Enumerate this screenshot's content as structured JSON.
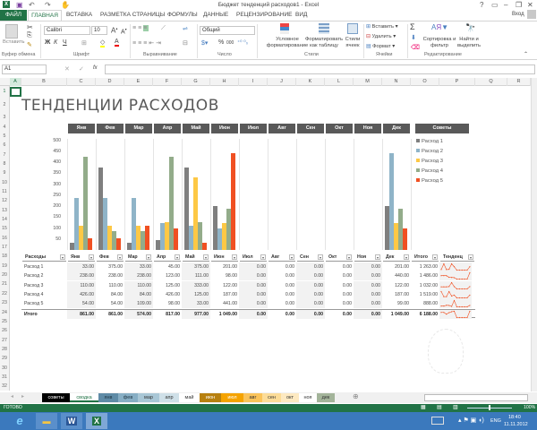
{
  "window": {
    "title": "Бюджет тенденций расходов1 - Excel",
    "help": "?",
    "user": "Вход"
  },
  "ribbon_tabs": [
    "ФАЙЛ",
    "ГЛАВНАЯ",
    "ВСТАВКА",
    "РАЗМЕТКА СТРАНИЦЫ",
    "ФОРМУЛЫ",
    "ДАННЫЕ",
    "РЕЦЕНЗИРОВАНИЕ",
    "ВИД"
  ],
  "ribbon": {
    "paste": "Вставить",
    "font_name": "Calibri",
    "font_size": "10",
    "bold": "Ж",
    "italic": "К",
    "underline": "Ч",
    "number_format": "Общий",
    "percent": "%",
    "thousands": "000",
    "cond_format": "Условное форматирование",
    "format_table": "Форматировать как таблицу",
    "cell_styles": "Стили ячеек",
    "insert": "Вставить",
    "delete": "Удалить",
    "format": "Формат",
    "sum": "Σ",
    "sort": "Сортировка и фильтр",
    "find": "Найти и выделить",
    "groups": [
      "Буфер обмена",
      "Шрифт",
      "Выравнивание",
      "Число",
      "Стили",
      "Ячейки",
      "Редактирование"
    ]
  },
  "formula_bar": {
    "name_box": "A1",
    "fx": "fx",
    "value": ""
  },
  "columns": [
    "A",
    "B",
    "C",
    "D",
    "E",
    "F",
    "G",
    "H",
    "I",
    "J",
    "K",
    "L",
    "M",
    "N",
    "O",
    "P",
    "Q",
    "R"
  ],
  "rows": [
    "1",
    "2",
    "3",
    "4",
    "5",
    "6",
    "7",
    "8",
    "9",
    "10",
    "11",
    "12",
    "13",
    "14",
    "15",
    "16",
    "17",
    "18",
    "19",
    "20",
    "21",
    "22",
    "23",
    "24",
    "25",
    "26",
    "27",
    "28",
    "29",
    "30",
    "31",
    "32"
  ],
  "sheet_title": "ТЕНДЕНЦИИ РАСХОДОВ",
  "tips_header": "Советы",
  "colors": {
    "Расход 1": "#7f7f7f",
    "Расход 2": "#8fb4c8",
    "Расход 3": "#fdc845",
    "Расход 4": "#93ac8a",
    "Расход 5": "#f05022",
    "header": "#595959",
    "excel_green": "#217346"
  },
  "chart_data": {
    "type": "bar",
    "title": "",
    "xlabel": "",
    "ylabel": "",
    "ylim": [
      0,
      500
    ],
    "y_ticks": [
      "500",
      "450",
      "400",
      "350",
      "300",
      "250",
      "200",
      "150",
      "100",
      "50"
    ],
    "categories": [
      "Янв",
      "Фев",
      "Мар",
      "Апр",
      "Май",
      "Июн",
      "Июл",
      "Авг",
      "Сен",
      "Окт",
      "Ноя",
      "Дек"
    ],
    "legend_position": "right",
    "series": [
      {
        "name": "Расход 1",
        "values": [
          33,
          375,
          33,
          45,
          375,
          201,
          0,
          0,
          0,
          0,
          0,
          201
        ]
      },
      {
        "name": "Расход 2",
        "values": [
          238,
          238,
          238,
          123,
          111,
          98,
          0,
          0,
          0,
          0,
          0,
          440
        ]
      },
      {
        "name": "Расход 3",
        "values": [
          110,
          110,
          110,
          125,
          333,
          122,
          0,
          0,
          0,
          0,
          0,
          122
        ]
      },
      {
        "name": "Расход 4",
        "values": [
          426,
          84,
          84,
          426,
          125,
          187,
          0,
          0,
          0,
          0,
          0,
          187
        ]
      },
      {
        "name": "Расход 5",
        "values": [
          54,
          54,
          109,
          98,
          33,
          441,
          0,
          0,
          0,
          0,
          0,
          99
        ]
      }
    ]
  },
  "table": {
    "headers": [
      "Расходы",
      "Янв",
      "Фев",
      "Мар",
      "Апр",
      "Май",
      "Июн",
      "Июл",
      "Авг",
      "Сен",
      "Окт",
      "Ноя",
      "Дек",
      "Итого",
      "Тенденц"
    ],
    "rows": [
      [
        "Расход 1",
        "33.00",
        "375.00",
        "33.00",
        "45.00",
        "375.00",
        "201.00",
        "0.00",
        "0.00",
        "0.00",
        "0.00",
        "0.00",
        "201.00",
        "1 263.00"
      ],
      [
        "Расход 2",
        "238.00",
        "238.00",
        "238.00",
        "123.00",
        "111.00",
        "98.00",
        "0.00",
        "0.00",
        "0.00",
        "0.00",
        "0.00",
        "440.00",
        "1 486.00"
      ],
      [
        "Расход 3",
        "110.00",
        "110.00",
        "110.00",
        "125.00",
        "333.00",
        "122.00",
        "0.00",
        "0.00",
        "0.00",
        "0.00",
        "0.00",
        "122.00",
        "1 032.00"
      ],
      [
        "Расход 4",
        "426.00",
        "84.00",
        "84.00",
        "426.00",
        "125.00",
        "187.00",
        "0.00",
        "0.00",
        "0.00",
        "0.00",
        "0.00",
        "187.00",
        "1 519.00"
      ],
      [
        "Расход 5",
        "54.00",
        "54.00",
        "109.00",
        "98.00",
        "33.00",
        "441.00",
        "0.00",
        "0.00",
        "0.00",
        "0.00",
        "0.00",
        "99.00",
        "888.00"
      ]
    ],
    "total": [
      "Итого",
      "861.00",
      "861.00",
      "574.00",
      "817.00",
      "977.00",
      "1 049.00",
      "0.00",
      "0.00",
      "0.00",
      "0.00",
      "0.00",
      "1 049.00",
      "6 188.00"
    ]
  },
  "sheet_tabs": [
    {
      "label": "советы",
      "bg": "#000000",
      "fg": "#ffffff"
    },
    {
      "label": "сводка",
      "bg": "#ffffff",
      "fg": "#217346"
    },
    {
      "label": "янв",
      "bg": "#5f8ba6",
      "fg": "#1f3440"
    },
    {
      "label": "фев",
      "bg": "#87aec4",
      "fg": "#1f3440"
    },
    {
      "label": "мар",
      "bg": "#a9c7d6",
      "fg": "#333333"
    },
    {
      "label": "апр",
      "bg": "#cfe0e8",
      "fg": "#333333"
    },
    {
      "label": "май",
      "bg": "#ffffff",
      "fg": "#333333"
    },
    {
      "label": "июн",
      "bg": "#b7800f",
      "fg": "#ffffff"
    },
    {
      "label": "июл",
      "bg": "#f5a300",
      "fg": "#ffffff"
    },
    {
      "label": "авг",
      "bg": "#fac35a",
      "fg": "#333333"
    },
    {
      "label": "сен",
      "bg": "#fcdc98",
      "fg": "#333333"
    },
    {
      "label": "окт",
      "bg": "#fde9c1",
      "fg": "#333333"
    },
    {
      "label": "ноя",
      "bg": "#ffffff",
      "fg": "#333333"
    },
    {
      "label": "дек",
      "bg": "#a3b49a",
      "fg": "#333333"
    }
  ],
  "status": {
    "ready": "ГОТОВО",
    "zoom": "100%"
  },
  "taskbar": {
    "lang": "ENG",
    "time": "18:40",
    "date": "11.11.2012"
  }
}
